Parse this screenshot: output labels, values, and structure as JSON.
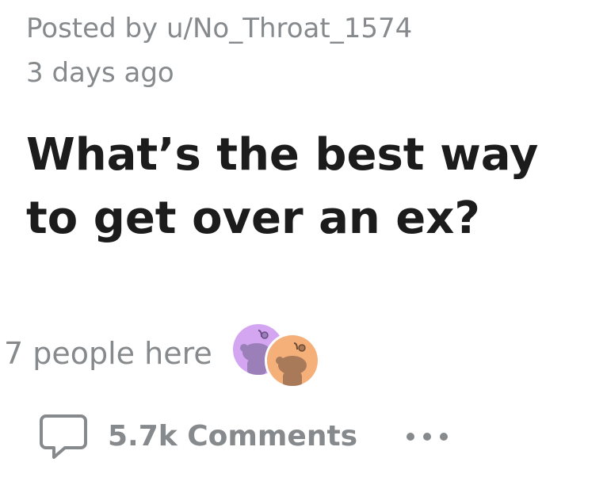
{
  "post": {
    "posted_by": "Posted by u/No_Throat_1574",
    "age": "3 days ago",
    "title": "What’s the best way to get over an ex?"
  },
  "presence": {
    "label": "7 people here",
    "avatars": [
      {
        "icon": "snoo-avatar-icon",
        "background": "#d4a6f2",
        "body": "#9a7fb8"
      },
      {
        "icon": "snoo-avatar-icon",
        "background": "#f5b07a",
        "body": "#a87a5a"
      }
    ]
  },
  "actions": {
    "comments_label": "5.7k Comments",
    "comments_icon": "comment-bubble-icon",
    "more_icon": "more-options-icon"
  },
  "colors": {
    "title": "#1c1c1c",
    "muted": "#878a8c"
  }
}
